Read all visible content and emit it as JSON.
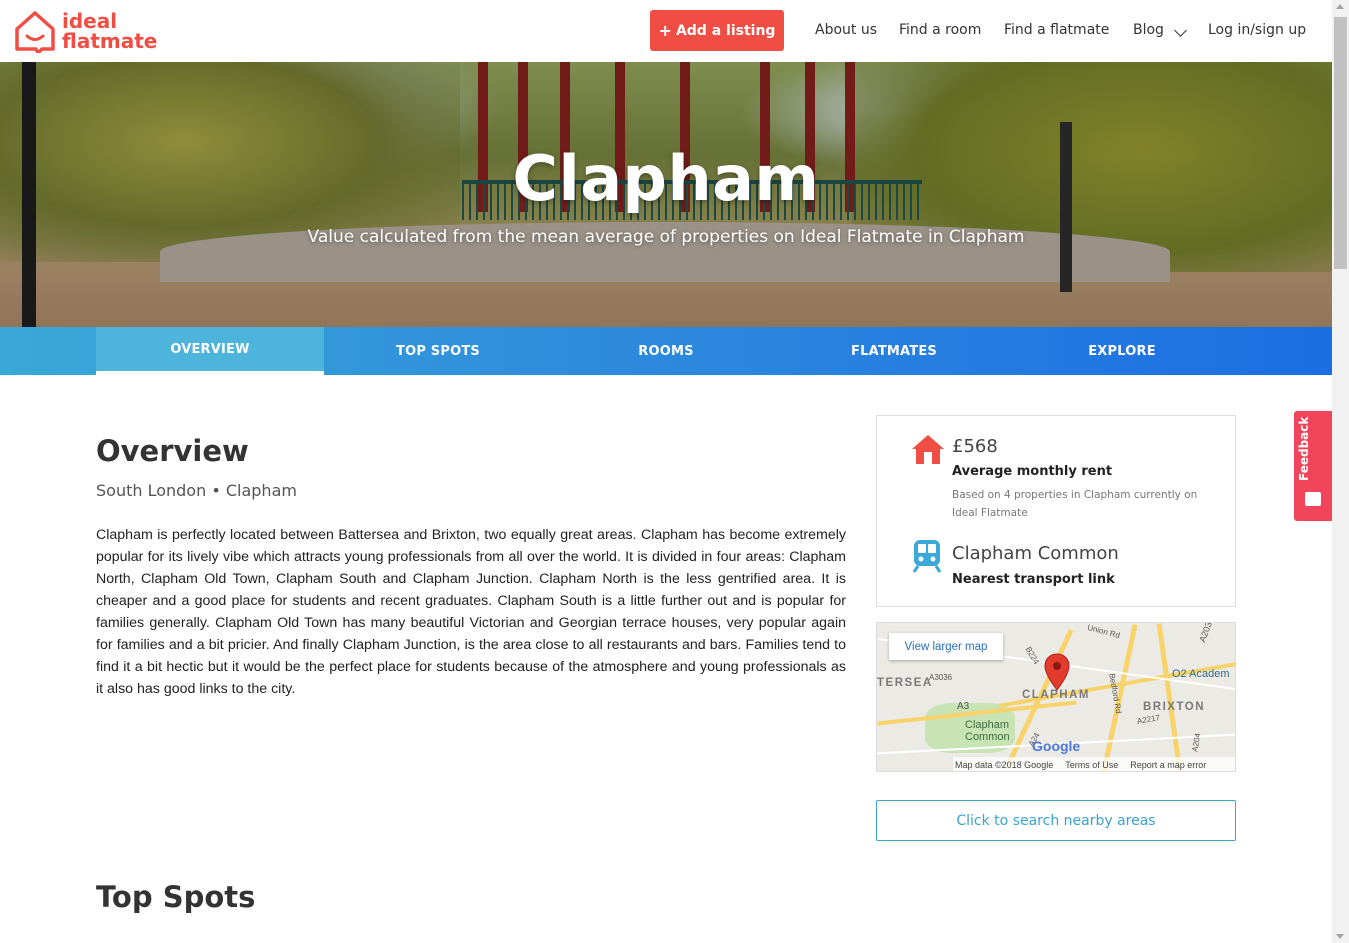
{
  "brand": {
    "line1": "ideal",
    "line2": "flatmate",
    "color": "#f04e45"
  },
  "header": {
    "add_listing": "Add a listing",
    "nav": [
      "About us",
      "Find a room",
      "Find a flatmate",
      "Blog",
      "Log in/sign up"
    ]
  },
  "hero": {
    "title": "Clapham",
    "subtitle": "Value calculated from the mean average of properties on Ideal Flatmate in Clapham"
  },
  "tabs": [
    {
      "label": "OVERVIEW",
      "active": true
    },
    {
      "label": "TOP SPOTS",
      "active": false
    },
    {
      "label": "ROOMS",
      "active": false
    },
    {
      "label": "FLATMATES",
      "active": false
    },
    {
      "label": "EXPLORE",
      "active": false
    }
  ],
  "overview": {
    "title": "Overview",
    "breadcrumb": "South London • Clapham",
    "body": "Clapham is perfectly located between Battersea and Brixton, two equally great areas. Clapham has become extremely popular for its lively vibe which attracts young professionals from all over the world. It is divided in four areas: Clapham North, Clapham Old Town, Clapham South and Clapham Junction. Clapham North is the less gentrified area. It is cheaper and a good place for students and recent graduates. Clapham South is a little further out and is popular for families generally.  Clapham Old Town has many beautiful Victorian and Georgian terrace houses, very popular again for families and a bit pricier. And finally Clapham Junction, is the area close to all restaurants and bars. Families tend to find it a bit hectic but it would be the perfect place for students because of the atmosphere and young professionals as it also has good links to the city."
  },
  "info": {
    "rent": "£568",
    "rent_label": "Average monthly rent",
    "rent_note": "Based on 4 properties in Clapham currently on Ideal Flatmate",
    "transport": "Clapham Common",
    "transport_label": "Nearest transport link",
    "icons": [
      "house-icon",
      "train-icon"
    ]
  },
  "map": {
    "larger_map": "View larger map",
    "labels": {
      "clapham": "CLAPHAM",
      "brixton": "BRIXTON",
      "battersea": "TERSEA",
      "common": "Clapham\nCommon",
      "o2": "O2 Academ",
      "a3": "A3",
      "a3036": "A3036",
      "a203": "A203",
      "a24": "A24",
      "a2217": "A2217",
      "a204": "A204",
      "b224": "B224",
      "bedford": "Bedford Rd",
      "union": "Union Rd"
    },
    "google": "Google",
    "footer": [
      "Map data ©2018 Google",
      "Terms of Use",
      "Report a map error"
    ]
  },
  "search_nearby": "Click to search nearby areas",
  "top_spots_title": "Top Spots",
  "feedback": "Feedback",
  "colors": {
    "accent": "#f04e45",
    "tab_start": "#3aa8d8",
    "tab_end": "#1c6ee3",
    "link": "#3aa3d0"
  }
}
